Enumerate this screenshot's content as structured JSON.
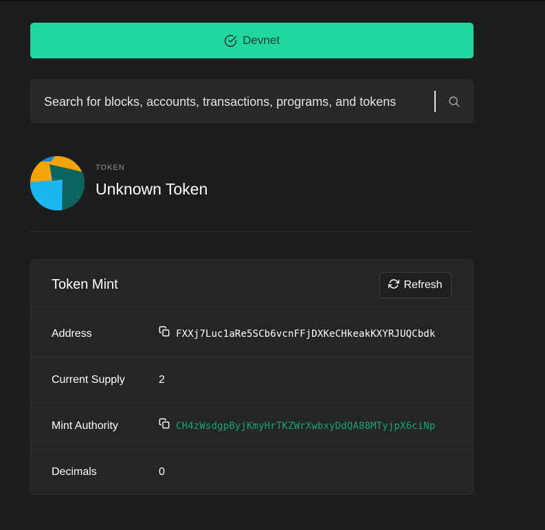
{
  "cluster": {
    "label": "Devnet",
    "icon": "check-circle-icon",
    "color": "#1fd89d"
  },
  "search": {
    "placeholder": "Search for blocks, accounts, transactions, programs, and tokens",
    "icon": "search-icon"
  },
  "header": {
    "eyebrow": "TOKEN",
    "title": "Unknown Token"
  },
  "card": {
    "title": "Token Mint",
    "refresh_label": "Refresh",
    "rows": [
      {
        "label": "Address",
        "value": "FXXj7Luc1aRe5SCb6vcnFFjDXKeCHkeakKXYRJUQCbdk"
      },
      {
        "label": "Current Supply",
        "value": "2"
      },
      {
        "label": "Mint Authority",
        "value": "CH4zWsdgpByjKmyHrTKZWrXwbxyDdQA88MTyjpX6ciNp"
      },
      {
        "label": "Decimals",
        "value": "0"
      }
    ]
  },
  "colors": {
    "background": "#1c1d1e",
    "accent": "#1fd89d",
    "link": "#1aa673"
  }
}
